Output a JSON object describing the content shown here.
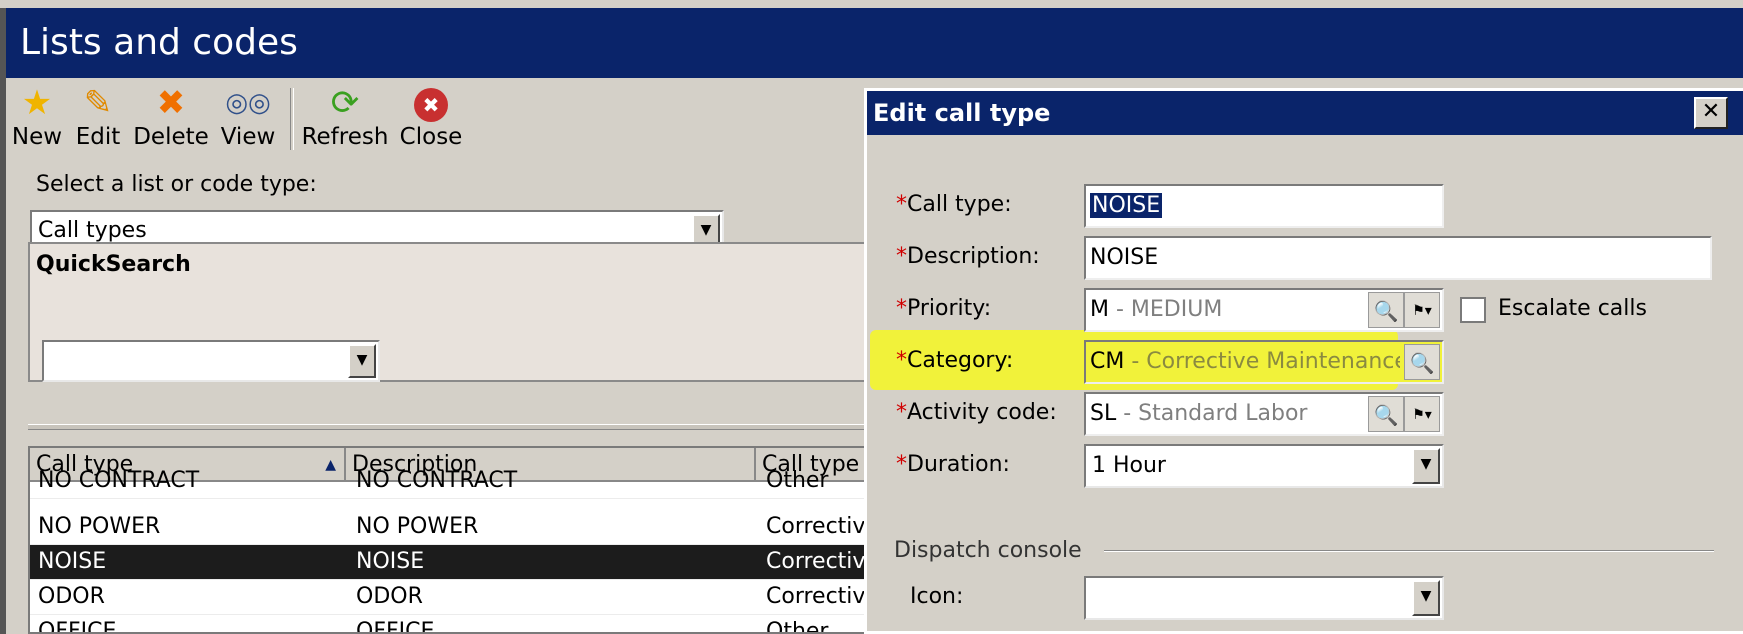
{
  "window": {
    "title": "Lists and codes"
  },
  "toolbar": [
    {
      "label": "New",
      "icon": "star-icon",
      "glyph": "★",
      "color": "#f0b400"
    },
    {
      "label": "Edit",
      "icon": "pencil-icon",
      "glyph": "✎",
      "color": "#e08a00"
    },
    {
      "label": "Delete",
      "icon": "delete-x-icon",
      "glyph": "✖",
      "color": "#f07000"
    },
    {
      "label": "View",
      "icon": "binoculars-icon",
      "glyph": "👓",
      "color": "#30508a"
    },
    {
      "label": "Refresh",
      "icon": "refresh-icon",
      "glyph": "⟳",
      "color": "#3aa020"
    },
    {
      "label": "Close",
      "icon": "close-icon",
      "glyph": "✖",
      "color": "#c83030"
    }
  ],
  "list_selector": {
    "label": "Select a list or code type:",
    "value": "Call types"
  },
  "quicksearch": {
    "title": "QuickSearch",
    "value": ""
  },
  "grid": {
    "columns": [
      "Call type",
      "Description",
      "Call type"
    ],
    "rows": [
      {
        "code": "NO CONTRACT",
        "description": "NO CONTRACT",
        "category": "Other",
        "selected": false
      },
      {
        "code": "NO POWER",
        "description": "NO POWER",
        "category": "Correctiv",
        "selected": false
      },
      {
        "code": "NOISE",
        "description": "NOISE",
        "category": "Correctiv",
        "selected": true
      },
      {
        "code": "ODOR",
        "description": "ODOR",
        "category": "Correctiv",
        "selected": false
      },
      {
        "code": "OFFICE",
        "description": "OFFICE",
        "category": "Other",
        "selected": false
      }
    ]
  },
  "dialog": {
    "title": "Edit call type",
    "close_glyph": "✕",
    "fields": {
      "call_type": {
        "label": "Call type:",
        "value": "NOISE"
      },
      "description": {
        "label": "Description:",
        "value": "NOISE"
      },
      "priority": {
        "label": "Priority:",
        "code": "M",
        "desc": " - MEDIUM"
      },
      "category": {
        "label": "Category:",
        "code": "CM",
        "desc": " - Corrective Maintenance"
      },
      "activity_code": {
        "label": "Activity code:",
        "code": "SL",
        "desc": " - Standard Labor"
      },
      "duration": {
        "label": "Duration:",
        "value": "1  Hour"
      }
    },
    "escalate": {
      "label": "Escalate calls",
      "checked": false
    },
    "dispatch": {
      "section_label": "Dispatch console",
      "icon_label": "Icon:",
      "icon_value": ""
    },
    "required_mark": "*"
  },
  "colors": {
    "titlebar": "#0a246a",
    "highlight": "#f1f23a",
    "required": "#d00000",
    "selected_row": "#1c1c1c"
  }
}
